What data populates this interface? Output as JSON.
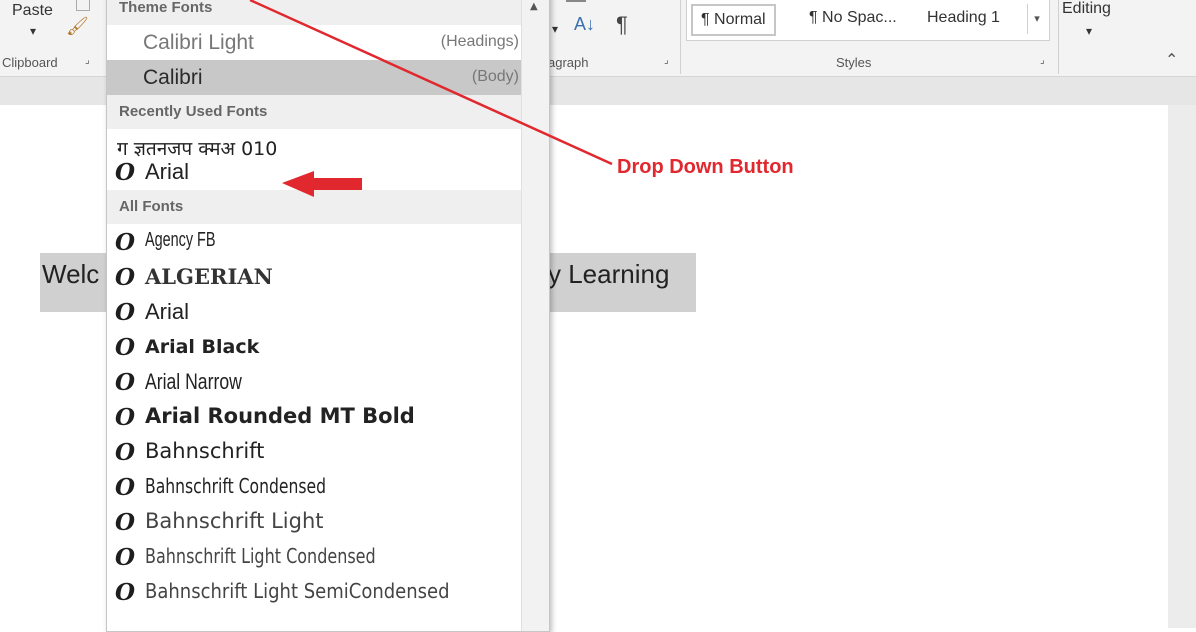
{
  "ribbon": {
    "paste_label": "Paste",
    "clipboard_label": "Clipboard",
    "paragraph_label_fragment": "agraph",
    "styles_label": "Styles",
    "editing_label": "Editing",
    "styles": [
      "¶ Normal",
      "¶ No Spac...",
      "Heading 1"
    ]
  },
  "document": {
    "text_left": "Welc",
    "text_right": "y Learning"
  },
  "font_dropdown": {
    "theme_fonts_header": "Theme Fonts",
    "theme_fonts": [
      {
        "name": "Calibri Light",
        "tag": "(Headings)"
      },
      {
        "name": "Calibri",
        "tag": "(Body)"
      }
    ],
    "recent_header": "Recently Used Fonts",
    "recent_fonts": [
      "ग ज्ञतनजप क्मअ 010",
      "Arial"
    ],
    "all_header": "All Fonts",
    "all_fonts": [
      "Agency FB",
      "ALGERIAN",
      "Arial",
      "Arial Black",
      "Arial Narrow",
      "Arial Rounded MT Bold",
      "Bahnschrift",
      "Bahnschrift Condensed",
      "Bahnschrift Light",
      "Bahnschrift Light Condensed",
      "Bahnschrift Light SemiCondensed"
    ]
  },
  "annotation": {
    "label": "Drop Down Button",
    "color": "#e0282e"
  }
}
